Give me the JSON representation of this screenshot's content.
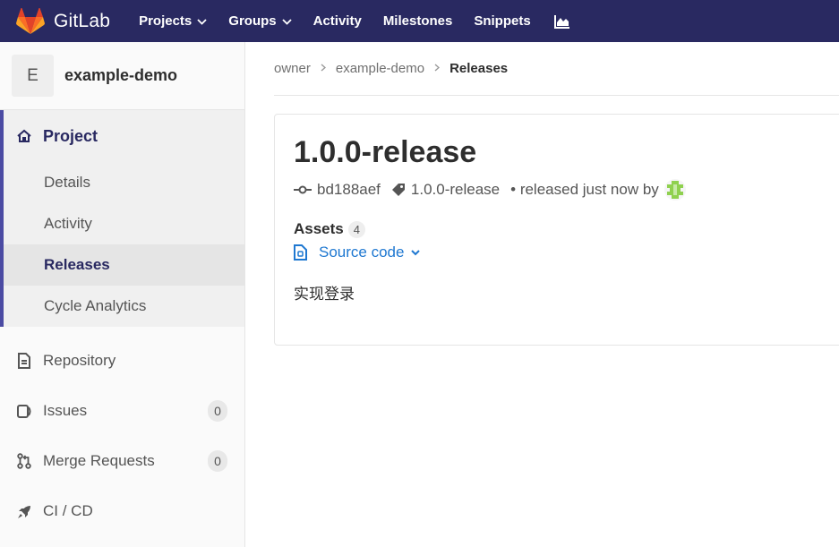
{
  "navbar": {
    "brand": "GitLab",
    "items": [
      {
        "label": "Projects",
        "dropdown": true
      },
      {
        "label": "Groups",
        "dropdown": true
      },
      {
        "label": "Activity",
        "dropdown": false
      },
      {
        "label": "Milestones",
        "dropdown": false
      },
      {
        "label": "Snippets",
        "dropdown": false
      }
    ],
    "chart_icon": "chart-icon",
    "background": "#292961"
  },
  "sidebar": {
    "context": {
      "avatar_letter": "E",
      "name": "example-demo"
    },
    "project": {
      "label": "Project",
      "icon": "home-icon",
      "items": [
        {
          "label": "Details"
        },
        {
          "label": "Activity"
        },
        {
          "label": "Releases",
          "current": true
        },
        {
          "label": "Cycle Analytics"
        }
      ]
    },
    "items": [
      {
        "label": "Repository",
        "icon": "document-icon"
      },
      {
        "label": "Issues",
        "icon": "issues-icon",
        "count": "0"
      },
      {
        "label": "Merge Requests",
        "icon": "merge-request-icon",
        "count": "0"
      },
      {
        "label": "CI / CD",
        "icon": "rocket-icon"
      }
    ]
  },
  "breadcrumb": {
    "items": [
      "owner",
      "example-demo"
    ],
    "current": "Releases"
  },
  "release": {
    "title": "1.0.0-release",
    "commit": "bd188aef",
    "tag": "1.0.0-release",
    "released_text": "• released just now by",
    "assets_label": "Assets",
    "assets_count": "4",
    "source_code_label": "Source code",
    "description": "实现登录"
  },
  "colors": {
    "accent": "#4b4ba3",
    "link": "#1f78d1",
    "identicon": "#8fd14f"
  }
}
